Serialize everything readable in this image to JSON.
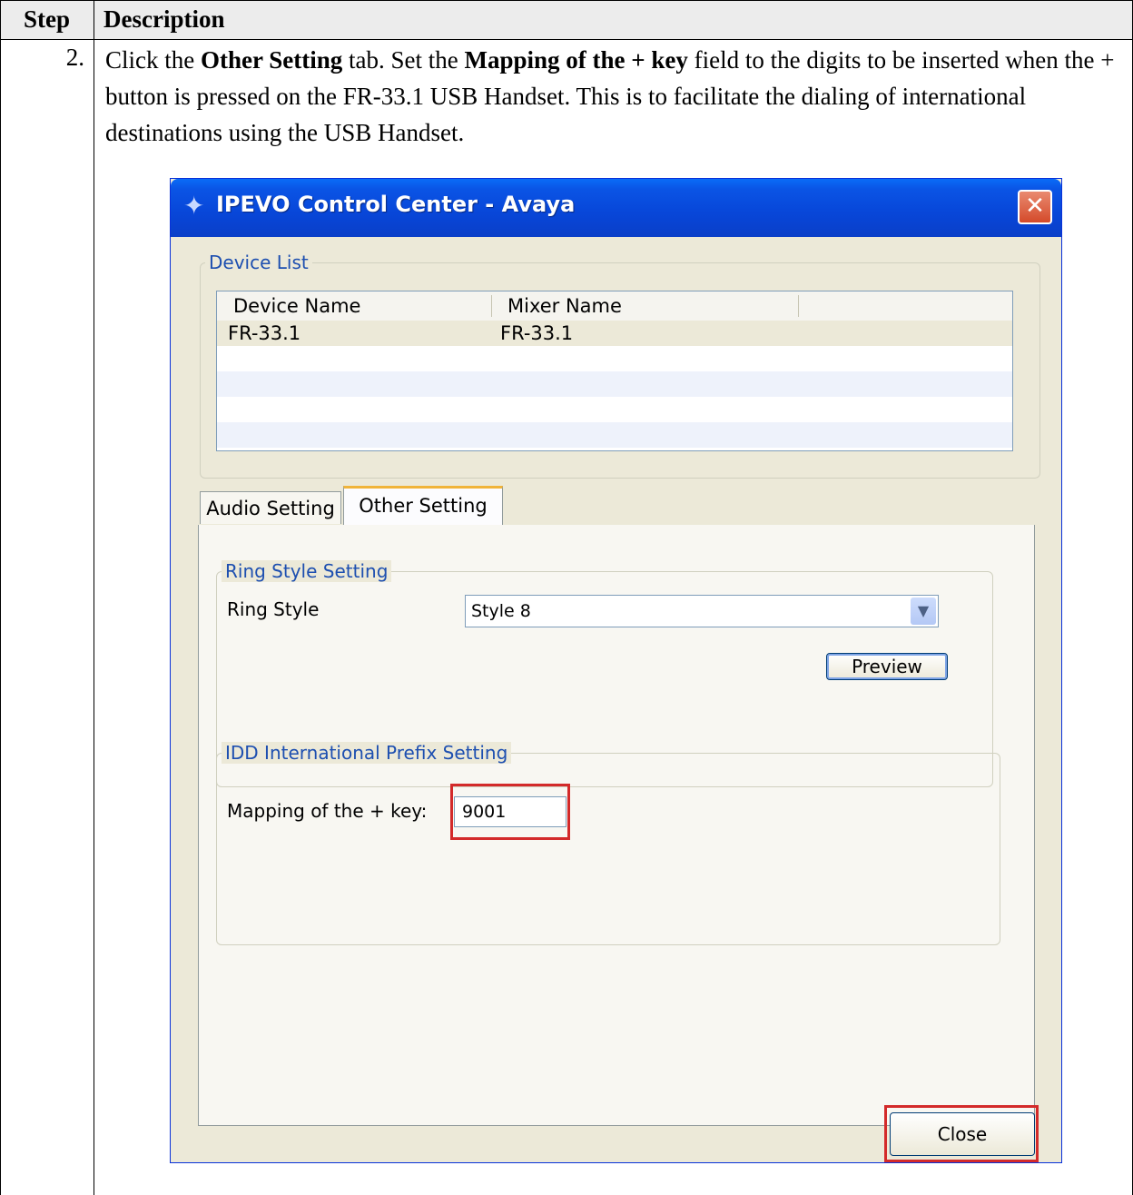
{
  "doc": {
    "header_step": "Step",
    "header_description": "Description",
    "step_number": "2.",
    "text": {
      "p1": "Click the ",
      "b1": "Other Setting",
      "p2": " tab. Set the ",
      "b2": "Mapping of the + key",
      "p3": " field to the digits to be inserted when the + button is pressed on the FR-33.1 USB Handset. This is to facilitate the dialing of international destinations using the USB Handset."
    }
  },
  "window": {
    "title": "IPEVO Control Center - Avaya",
    "close_glyph": "✕",
    "title_icon_glyph": "✦"
  },
  "device_list": {
    "legend": "Device List",
    "columns": [
      "Device Name",
      "Mixer Name"
    ],
    "rows": [
      {
        "device_name": "FR-33.1",
        "mixer_name": "FR-33.1"
      }
    ]
  },
  "tabs": {
    "audio": "Audio Setting",
    "other": "Other Setting",
    "active": "Other Setting"
  },
  "ring_style": {
    "legend": "Ring Style Setting",
    "label": "Ring Style",
    "value": "Style 8",
    "dropdown_glyph": "▼",
    "preview_label": "Preview"
  },
  "idd": {
    "legend": "IDD International Prefix Setting",
    "label": "Mapping of the + key:",
    "value": "9001"
  },
  "footer": {
    "close_label": "Close"
  },
  "colors": {
    "titlebar": "#0846d8",
    "highlight": "#d32a2a",
    "legend_text": "#1d4fb0"
  }
}
